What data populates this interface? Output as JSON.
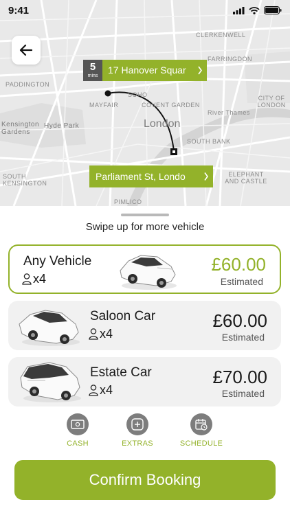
{
  "status_bar": {
    "time": "9:41",
    "icons": [
      "signal-icon",
      "wifi-icon",
      "battery-icon"
    ]
  },
  "map": {
    "areas": [
      "PADDINGTON",
      "MAYFAIR",
      "SOHO",
      "COVENT GARDEN",
      "CLERKENWELL",
      "FARRINGDON",
      "SOUTH BANK",
      "CITY OF LONDON",
      "ELEPHANT AND CASTLE",
      "PIMLICO",
      "SOUTH KENSINGTON",
      "Kensington Gardens",
      "Hyde Park",
      "London",
      "River Thames"
    ],
    "eta": {
      "value": "5",
      "unit": "mins"
    },
    "pickup": "17 Hanover Squar",
    "dropoff": "Parliament St, Londo"
  },
  "sheet": {
    "hint": "Swipe up for more vehicle",
    "vehicles": [
      {
        "name": "Any Vehicle",
        "passengers": "x4",
        "price": "£60.00",
        "note": "Estimated",
        "selected": true
      },
      {
        "name": "Saloon Car",
        "passengers": "x4",
        "price": "£60.00",
        "note": "Estimated",
        "selected": false
      },
      {
        "name": "Estate Car",
        "passengers": "x4",
        "price": "£70.00",
        "note": "Estimated",
        "selected": false
      }
    ],
    "options": [
      {
        "label": "CASH",
        "icon": "cash-icon"
      },
      {
        "label": "EXTRAS",
        "icon": "plus-icon"
      },
      {
        "label": "SCHEDULE",
        "icon": "calendar-icon"
      }
    ],
    "confirm_label": "Confirm Booking"
  },
  "colors": {
    "accent": "#93b22a",
    "map_bg": "#e9e9e9",
    "card_bg": "#f1f1f1",
    "eta_bg": "#555555"
  }
}
